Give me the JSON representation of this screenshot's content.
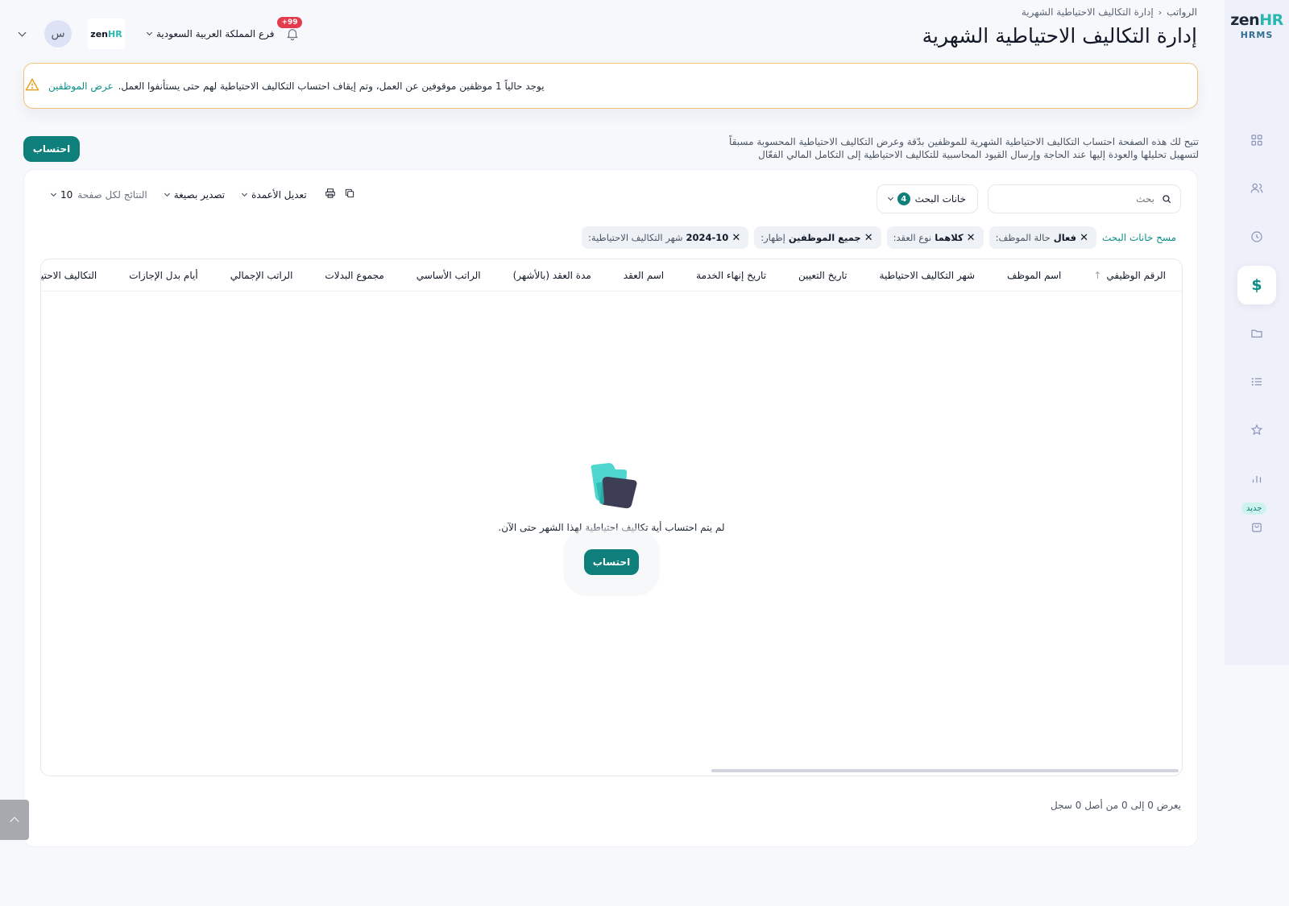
{
  "brand": {
    "name_part1": "zen",
    "name_part2": "HR",
    "product": "HRMS"
  },
  "sidebar": {
    "items": [
      {
        "icon": "grid-icon"
      },
      {
        "icon": "users-icon"
      },
      {
        "icon": "clock-icon"
      },
      {
        "icon": "dollar-icon",
        "label": "$",
        "active": true
      },
      {
        "icon": "folder-icon"
      },
      {
        "icon": "list-icon"
      },
      {
        "icon": "star-icon"
      },
      {
        "icon": "bar-chart-icon"
      },
      {
        "icon": "bag-icon"
      }
    ],
    "new_badge": "جديد"
  },
  "header": {
    "breadcrumb": {
      "parent": "الرواتب",
      "current": "إدارة التكاليف الاحتياطية الشهرية"
    },
    "title": "إدارة التكاليف الاحتياطية الشهرية",
    "branch": "فرع المملكة العربية السعودية",
    "notifications_count": "+99",
    "avatar_initial": "س",
    "company_logo": {
      "part1": "zen",
      "part2": "HR"
    }
  },
  "alert": {
    "text": "يوجد حالياً 1 موظفين موقوفين عن العمل، وتم إيقاف احتساب التكاليف الاحتياطية لهم حتى يستأنفوا العمل.",
    "link": "عرض الموظفين"
  },
  "description": "تتيح لك هذه الصفحة احتساب التكاليف الاحتياطية الشهرية للموظفين بدّقة وعرض التكاليف الاحتياطية المحسوبة مسبقاً لتسهيل تحليلها والعودة إليها عند الحاجة وإرسال القيود المحاسبية للتكاليف الاحتياطية إلى التكامل المالي الفعّال",
  "calculate_button": "احتساب",
  "toolbar": {
    "search_placeholder": "بحث",
    "filters_label": "خانات البحث",
    "filters_count": "4",
    "edit_columns": "تعديل الأعمدة",
    "export": "تصدير بصيغة",
    "per_page_label": "النتائج لكل صفحة",
    "per_page_value": "10"
  },
  "chips": [
    {
      "label": "شهر التكاليف الاحتياطية:",
      "value": "2024-10"
    },
    {
      "label": "إظهار:",
      "value": "جميع الموظفين"
    },
    {
      "label": "نوع العقد:",
      "value": "كلاهما"
    },
    {
      "label": "حالة الموظف:",
      "value": "فعال"
    }
  ],
  "clear_filters": "مسح خانات البحث",
  "table": {
    "columns": [
      "الرقم الوظيفي",
      "اسم الموظف",
      "شهر التكاليف الاحتياطية",
      "تاريخ التعيين",
      "تاريخ إنهاء الخدمة",
      "اسم العقد",
      "مدة العقد (بالأشهر)",
      "الراتب الأساسي",
      "مجموع البدلات",
      "الراتب الإجمالي",
      "أيام بدل الإجازات",
      "التكاليف الاحتياطية"
    ],
    "empty_text": "لم يتم احتساب أية تكاليف احتياطية لهذا الشهر حتى الآن.",
    "empty_button": "احتساب"
  },
  "footer": {
    "count_text": "يعرض 0 إلى 0 من أصل 0 سجل"
  },
  "colors": {
    "primary": "#0e7f7a",
    "accent": "#2bb7b1",
    "warning": "#e5a32a",
    "badge": "#e23b4e"
  }
}
